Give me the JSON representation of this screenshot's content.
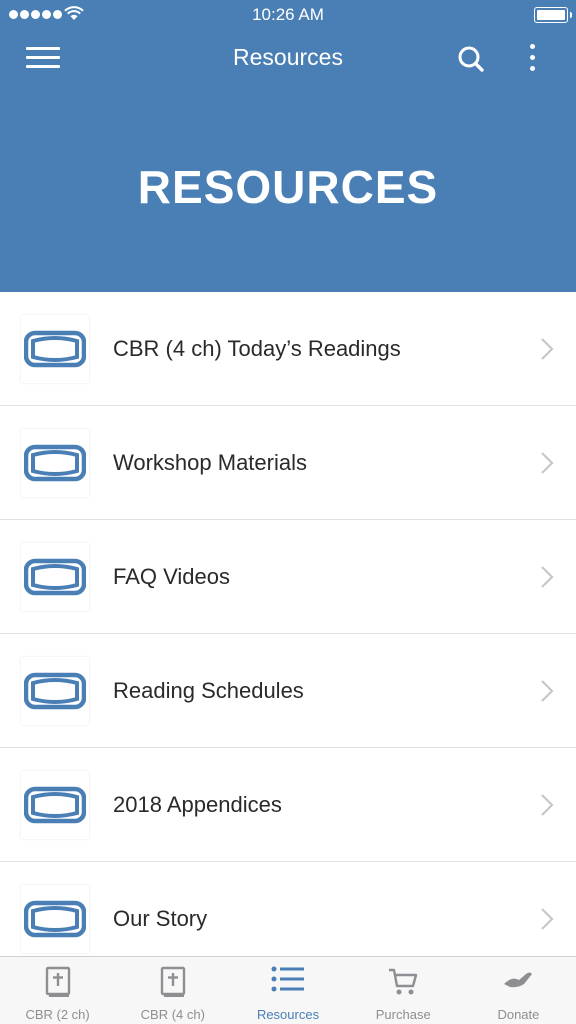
{
  "status_bar": {
    "time": "10:26 AM"
  },
  "nav": {
    "title": "Resources",
    "menu_icon": "hamburger-menu-icon",
    "search_icon": "search-icon",
    "more_icon": "more-vertical-icon"
  },
  "hero": {
    "title": "RESOURCES"
  },
  "list": {
    "items": [
      {
        "label": "CBR (4 ch) Today’s Readings",
        "icon": "book-icon"
      },
      {
        "label": "Workshop Materials",
        "icon": "book-icon"
      },
      {
        "label": "FAQ Videos",
        "icon": "book-icon"
      },
      {
        "label": "Reading Schedules",
        "icon": "book-icon"
      },
      {
        "label": "2018 Appendices",
        "icon": "book-icon"
      },
      {
        "label": "Our Story",
        "icon": "book-icon"
      }
    ]
  },
  "tabbar": {
    "tabs": [
      {
        "label": "CBR (2 ch)",
        "icon": "bible-icon",
        "active": false
      },
      {
        "label": "CBR (4 ch)",
        "icon": "bible-icon",
        "active": false
      },
      {
        "label": "Resources",
        "icon": "list-icon",
        "active": true
      },
      {
        "label": "Purchase",
        "icon": "cart-icon",
        "active": false
      },
      {
        "label": "Donate",
        "icon": "donate-hand-icon",
        "active": false
      }
    ]
  },
  "colors": {
    "brand": "#4a7fb5",
    "inactive": "#8e8e93",
    "separator": "#e1e1e1"
  }
}
